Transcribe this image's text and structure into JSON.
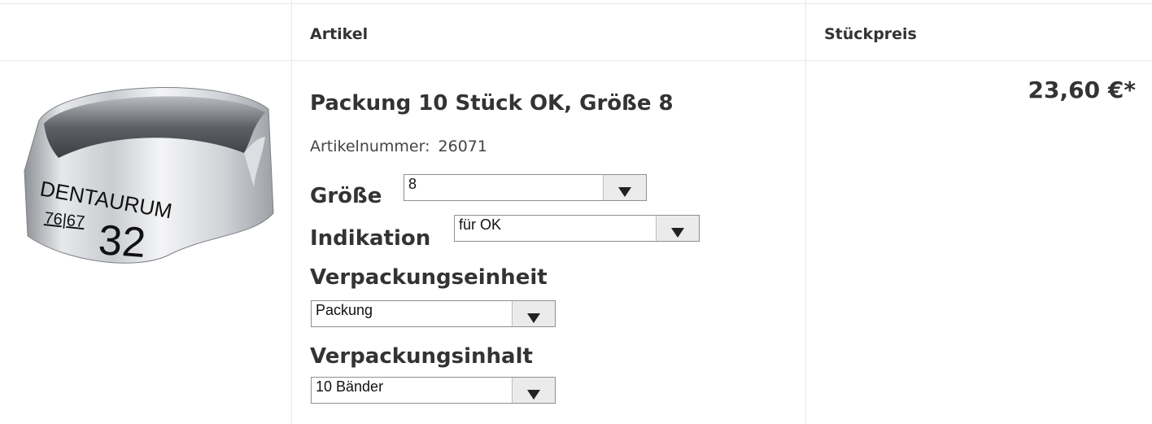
{
  "table": {
    "headers": {
      "article": "Artikel",
      "unit_price": "Stückpreis"
    }
  },
  "product": {
    "image": {
      "brand": "DENTAURUM",
      "numbers": "76|67",
      "size": "32"
    },
    "title": "Packung 10 Stück OK, Größe 8",
    "article_number_label": "Artikelnummer:",
    "article_number": "26071",
    "price": "23,60 €*"
  },
  "options": {
    "size": {
      "label": "Größe",
      "value": "8"
    },
    "indication": {
      "label": "Indikation",
      "value": "für OK"
    },
    "packaging_unit": {
      "label": "Verpackungseinheit",
      "value": "Packung"
    },
    "packaging_content": {
      "label": "Verpackungsinhalt",
      "value": "10 Bänder"
    }
  }
}
